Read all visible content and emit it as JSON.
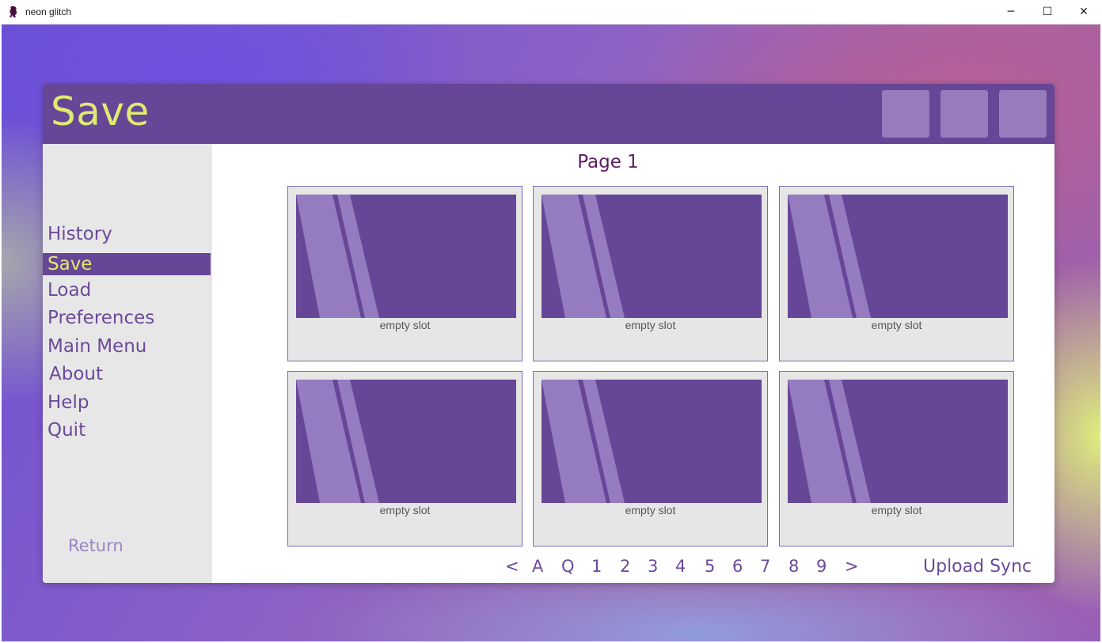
{
  "window": {
    "title": "neon glitch",
    "minimize": "─",
    "maximize": "☐",
    "close": "✕"
  },
  "screen": {
    "title": "Save",
    "header_buttons": [
      "",
      "",
      ""
    ]
  },
  "nav": {
    "items": [
      {
        "label": "History"
      },
      {
        "label": "Save",
        "selected": true
      },
      {
        "label": "Load"
      },
      {
        "label": "Preferences"
      },
      {
        "label": "Main Menu"
      },
      {
        "label": "About"
      },
      {
        "label": "Help"
      },
      {
        "label": "Quit"
      }
    ],
    "return_label": "Return"
  },
  "page": {
    "title": "Page 1"
  },
  "slots": [
    {
      "label": "empty slot"
    },
    {
      "label": "empty slot"
    },
    {
      "label": "empty slot"
    },
    {
      "label": "empty slot"
    },
    {
      "label": "empty slot"
    },
    {
      "label": "empty slot"
    }
  ],
  "pager": {
    "prev": "<",
    "auto": "A",
    "quick": "Q",
    "pages": [
      "1",
      "2",
      "3",
      "4",
      "5",
      "6",
      "7",
      "8",
      "9"
    ],
    "next": ">"
  },
  "upload_sync": "Upload Sync",
  "colors": {
    "panel_header": "#664696",
    "accent_text": "#e0ea70",
    "nav_text": "#6a4a9a",
    "page_title": "#5b1d62",
    "thumb": "#664696",
    "thumb_stripe": "#957bbf"
  }
}
